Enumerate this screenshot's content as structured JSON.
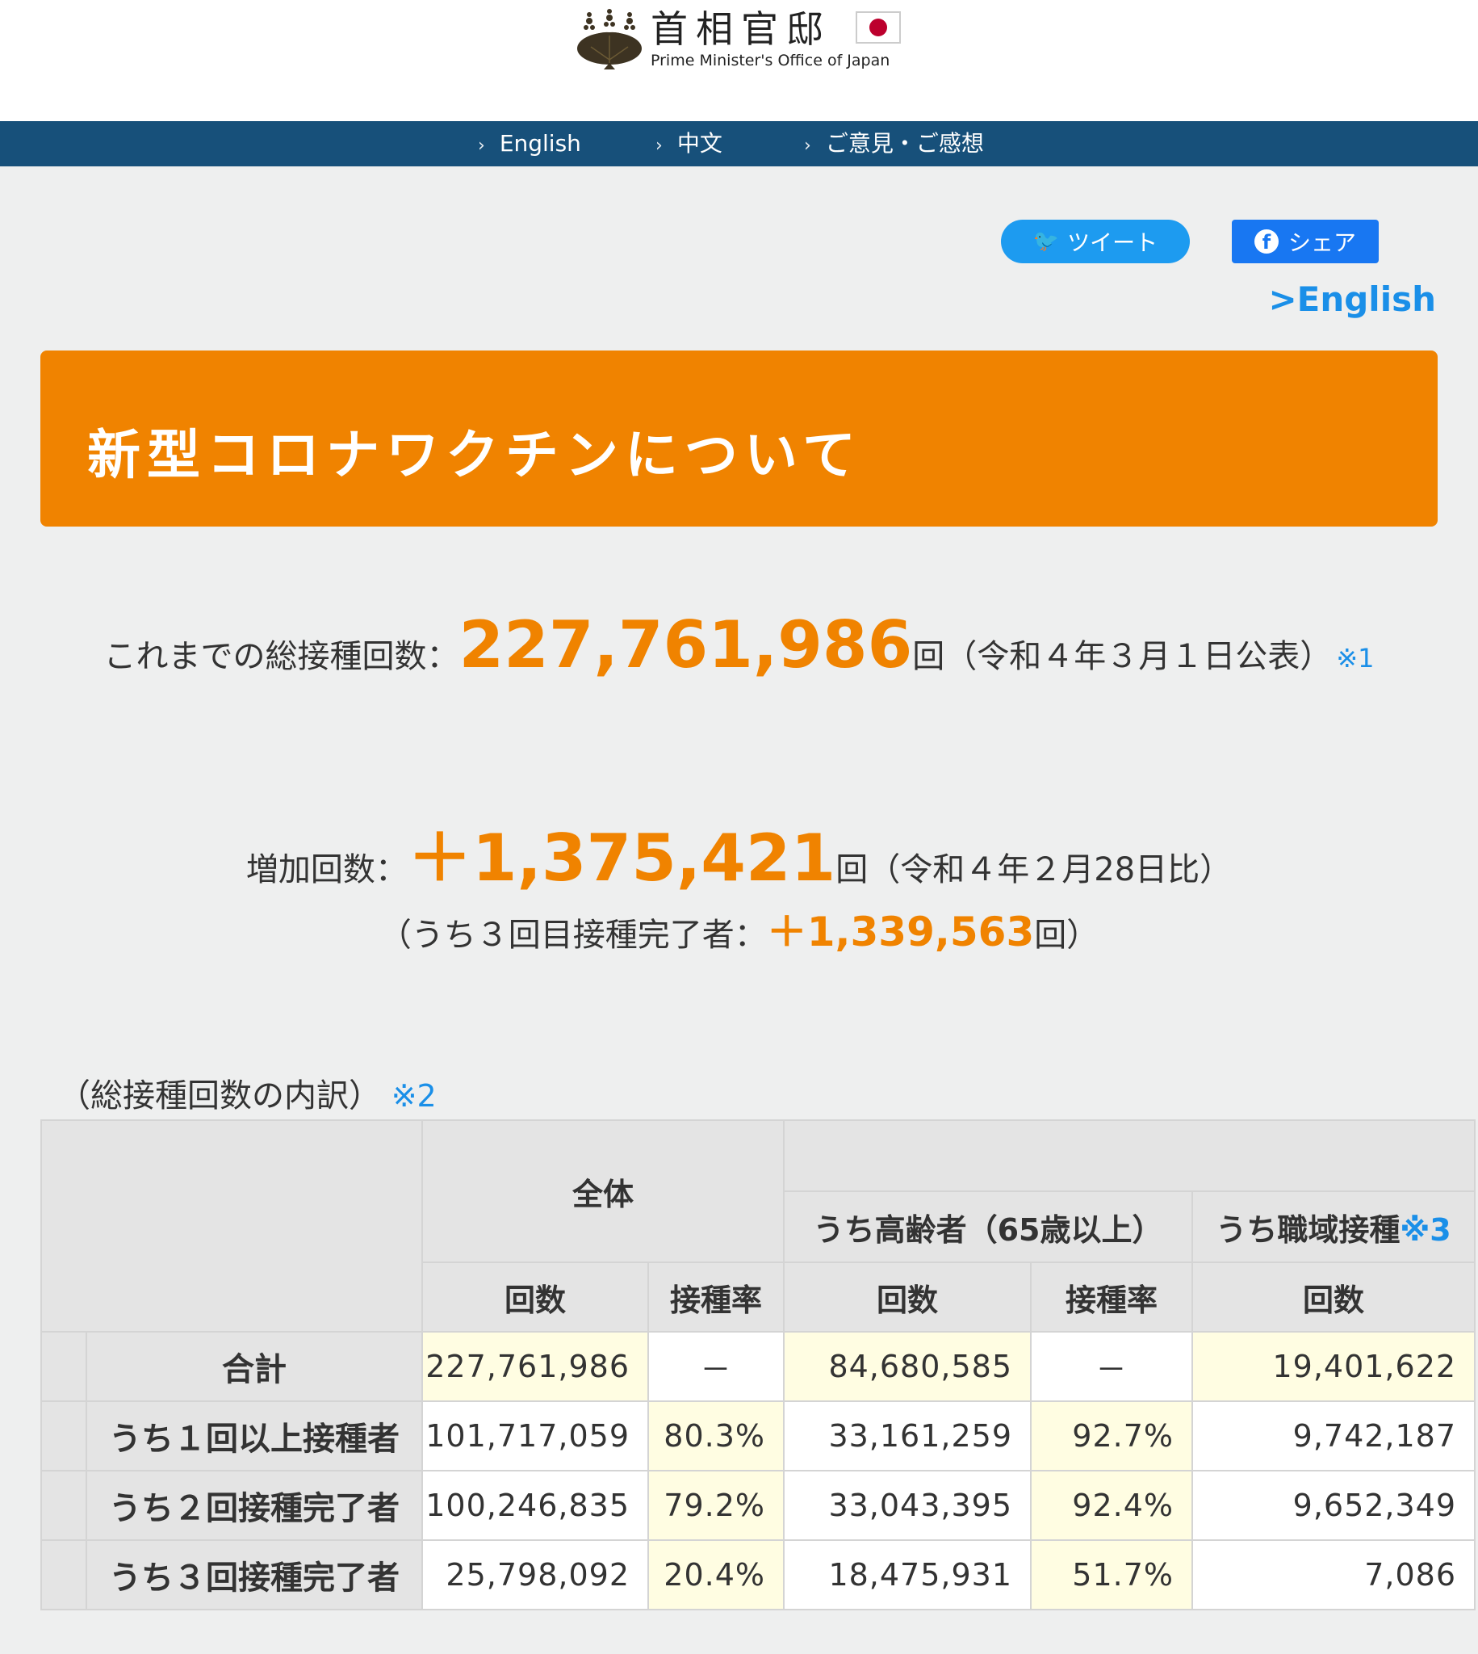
{
  "header": {
    "logo_jp": "首相官邸",
    "logo_en": "Prime Minister's Office of Japan"
  },
  "nav": {
    "items": [
      "English",
      "中文",
      "ご意見・ご感想"
    ]
  },
  "social": {
    "tweet_label": "ツイート",
    "share_label": "シェア"
  },
  "english_link": ">English",
  "banner": {
    "title": "新型コロナワクチンについて"
  },
  "stats": {
    "total_label": "これまでの総接種回数：",
    "total_value": "227,761,986",
    "total_unit": "回",
    "total_date": "（令和４年３月１日公表）",
    "total_note": "※1",
    "increase_label": "増加回数：",
    "increase_value": "＋1,375,421",
    "increase_unit": "回",
    "increase_date": "（令和４年２月28日比）",
    "third_prefix": "（うち３回目接種完了者：",
    "third_value": "＋1,339,563",
    "third_suffix": "回）"
  },
  "breakdown": {
    "label": "（総接種回数の内訳）",
    "note": "※2"
  },
  "table": {
    "group_all": "全体",
    "group_elderly": "うち高齢者（65歳以上）",
    "group_workplace": "うち職域接種",
    "group_workplace_note": "※3",
    "col_count": "回数",
    "col_rate": "接種率",
    "rows": [
      {
        "label": "合計",
        "all_count": "227,761,986",
        "all_rate": "－",
        "eld_count": "84,680,585",
        "eld_rate": "－",
        "work_count": "19,401,622"
      },
      {
        "label": "うち１回以上接種者",
        "all_count": "101,717,059",
        "all_rate": "80.3%",
        "eld_count": "33,161,259",
        "eld_rate": "92.7%",
        "work_count": "9,742,187"
      },
      {
        "label": "うち２回接種完了者",
        "all_count": "100,246,835",
        "all_rate": "79.2%",
        "eld_count": "33,043,395",
        "eld_rate": "92.4%",
        "work_count": "9,652,349"
      },
      {
        "label": "うち３回接種完了者",
        "all_count": "25,798,092",
        "all_rate": "20.4%",
        "eld_count": "18,475,931",
        "eld_rate": "51.7%",
        "work_count": "7,086"
      }
    ]
  },
  "colors": {
    "accent_orange": "#f08300",
    "nav_blue": "#17507a",
    "link_blue": "#1a8fe8",
    "highlight_cell": "#fffde2"
  }
}
